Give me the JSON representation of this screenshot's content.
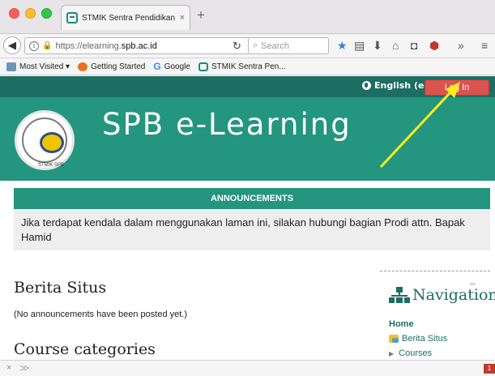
{
  "browser": {
    "tab_title": "STMIK Sentra Pendidikan Bisn",
    "tab_close": "×",
    "new_tab": "+",
    "url_prefix": "https://elearning.",
    "url_domain": "spb.ac.id",
    "search_placeholder": "Search",
    "bookmarks": [
      {
        "label": "Most Visited ▾",
        "icon": "folder-icon"
      },
      {
        "label": "Getting Started",
        "icon": "firefox-icon"
      },
      {
        "label": "Google",
        "icon": "google-icon"
      },
      {
        "label": "STMIK Sentra Pen...",
        "icon": "spb-icon"
      }
    ]
  },
  "site": {
    "language": "English (en)",
    "login_label": "Log In",
    "title": "SPB e-Learning",
    "logo_text": "STMIK SPB"
  },
  "announcements": {
    "heading": "ANNOUNCEMENTS",
    "text": "Jika terdapat kendala dalam menggunakan laman ini, silakan hubungi bagian Prodi attn. Bapak Hamid"
  },
  "main": {
    "news_heading": "Berita Situs",
    "no_announcements": "(No announcements have been posted yet.)",
    "categories_heading": "Course categories"
  },
  "navigation": {
    "title": "Navigation",
    "home": "Home",
    "items": [
      "Berita Situs",
      "Courses"
    ]
  },
  "statusbar": {
    "close": "×",
    "arrows": "≫",
    "badge": "1"
  },
  "colors": {
    "theme_dark": "#1c6e62",
    "theme_main": "#24957f",
    "login_red": "#d9534f",
    "arrow_yellow": "#f5f01c"
  }
}
